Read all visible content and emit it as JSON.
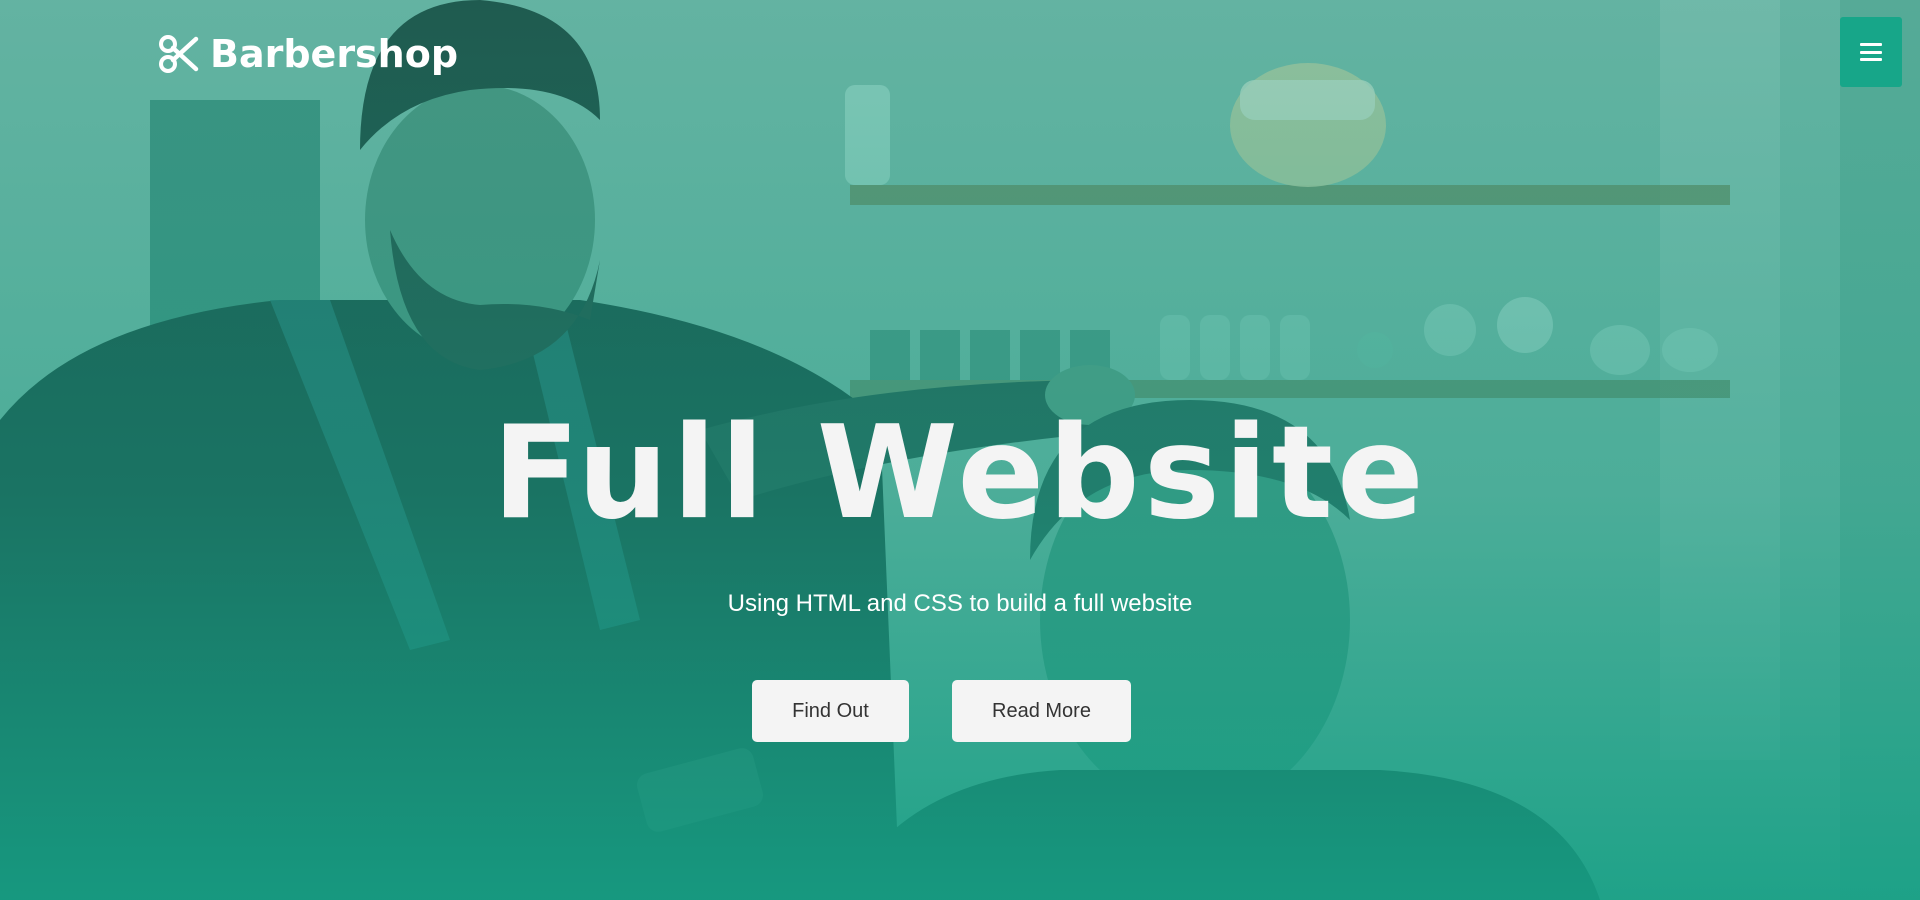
{
  "brand": {
    "name": "Barbershop",
    "icon": "scissors-icon"
  },
  "nav": {
    "menu_icon": "hamburger-menu-icon"
  },
  "hero": {
    "title": "Full Website",
    "subtitle": "Using HTML and CSS to build a full website",
    "buttons": [
      {
        "label": "Find Out"
      },
      {
        "label": "Read More"
      }
    ],
    "background": "photo of smiling barber cutting a smiling client's hair in a barbershop with shelves"
  },
  "colors": {
    "accent": "#17a689",
    "button_bg": "#f4f4f4",
    "button_text": "#333333",
    "text_light": "#ffffff"
  }
}
